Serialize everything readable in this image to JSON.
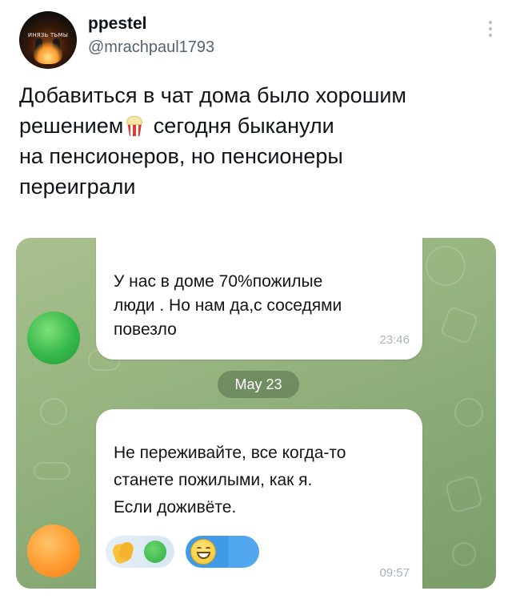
{
  "tweet": {
    "display_name": "ppestel",
    "handle": "@mrachpaul1793",
    "avatar_caption": "ИНЯЗЬ ТЬМЫ",
    "text_lines": [
      "Добавиться в чат дома было хорошим",
      "решением",
      "сегодня быканули",
      "на пенсионеров, но пенсионеры",
      "переиграли"
    ],
    "emoji": "popcorn"
  },
  "chat": {
    "background_color": "#98b580",
    "date_separator": "May 23",
    "messages": [
      {
        "lines": [
          "У нас в доме 70%пожилые",
          "люди . Но нам да,с соседями",
          "повезло"
        ],
        "time": "23:46",
        "avatar_color": "#35b84a"
      },
      {
        "lines": [
          "Не переживайте, все когда-то",
          "станете пожилыми, как я.",
          "Если доживёте."
        ],
        "time": "09:57",
        "avatar_color": "#ff9b2f",
        "reactions": [
          "clapping-hands",
          "green-avatar",
          "grinning-face"
        ]
      }
    ]
  }
}
